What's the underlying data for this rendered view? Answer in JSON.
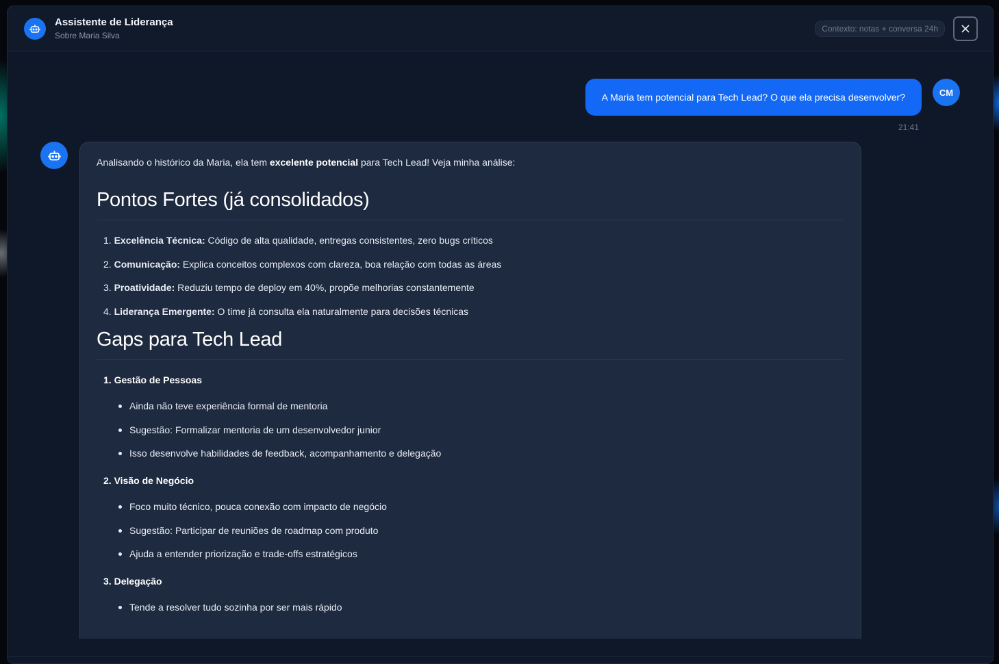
{
  "header": {
    "title": "Assistente de Liderança",
    "subtitle": "Sobre Maria Silva",
    "context_badge": "Contexto: notas + conversa 24h",
    "close_icon": "close-icon"
  },
  "user_message": {
    "text": "A Maria tem potencial para Tech Lead? O que ela precisa desenvolver?",
    "time": "21:41",
    "avatar_initials": "CM"
  },
  "bot_message": {
    "intro_prefix": "Analisando o histórico da Maria, ela tem ",
    "intro_bold": "excelente potencial",
    "intro_suffix": " para Tech Lead! Veja minha análise:",
    "strengths_heading": "Pontos Fortes (já consolidados)",
    "strengths": [
      {
        "num": "1.",
        "title": "Excelência Técnica:",
        "text": " Código de alta qualidade, entregas consistentes, zero bugs críticos"
      },
      {
        "num": "2.",
        "title": "Comunicação:",
        "text": " Explica conceitos complexos com clareza, boa relação com todas as áreas"
      },
      {
        "num": "3.",
        "title": "Proatividade:",
        "text": " Reduziu tempo de deploy em 40%, propõe melhorias constantemente"
      },
      {
        "num": "4.",
        "title": "Liderança Emergente:",
        "text": " O time já consulta ela naturalmente para decisões técnicas"
      }
    ],
    "gaps_heading": "Gaps para Tech Lead",
    "gaps": [
      {
        "num": "1.",
        "title": "Gestão de Pessoas",
        "items": [
          "Ainda não teve experiência formal de mentoria",
          "Sugestão: Formalizar mentoria de um desenvolvedor junior",
          "Isso desenvolve habilidades de feedback, acompanhamento e delegação"
        ]
      },
      {
        "num": "2.",
        "title": "Visão de Negócio",
        "items": [
          "Foco muito técnico, pouca conexão com impacto de negócio",
          "Sugestão: Participar de reuniões de roadmap com produto",
          "Ajuda a entender priorização e trade-offs estratégicos"
        ]
      },
      {
        "num": "3.",
        "title": "Delegação",
        "items": [
          "Tende a resolver tudo sozinha por ser mais rápido"
        ]
      }
    ]
  },
  "colors": {
    "accent": "#1a73f0",
    "user_bubble": "#1369f5",
    "bot_bubble": "#1e2a3f",
    "modal_bg": "#0f1829"
  }
}
